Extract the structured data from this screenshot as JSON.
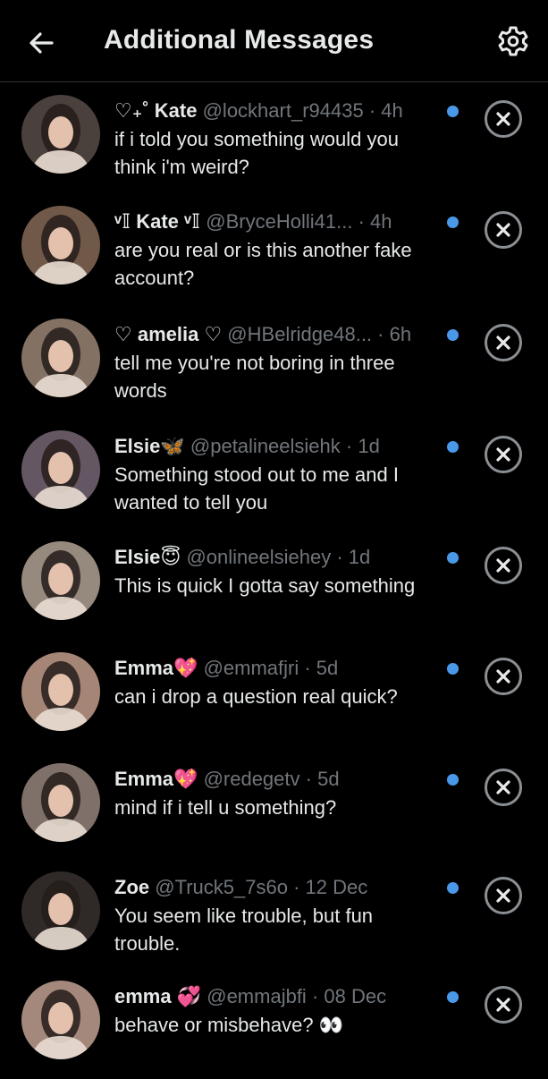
{
  "header": {
    "title": "Additional Messages",
    "back_icon": "arrow-left-icon",
    "settings_icon": "gear-icon"
  },
  "colors": {
    "background": "#000000",
    "text": "#e7e9ea",
    "muted": "#71767b",
    "accent": "#4a99e9"
  },
  "messages": [
    {
      "name": "♡₊˚ Kate",
      "handle": "@lockhart_r94435",
      "time": "4h",
      "text": "if i told you something would you think i'm weird?",
      "avatar": "#5b4f4a"
    },
    {
      "name": "ᵛ𝕀 Kate ᵛ𝕀",
      "handle": "@BryceHolli41...",
      "time": "4h",
      "text": "are you real or is this another fake account?",
      "avatar": "#8a6d5a"
    },
    {
      "name": "♡ amelia ♡",
      "handle": "@HBelridge48...",
      "time": "6h",
      "text": "tell me you're not boring in three words",
      "avatar": "#a08a7a"
    },
    {
      "name": "Elsie🦋",
      "handle": "@petalineelsiehk",
      "time": "1d",
      "text": "Something stood out to me and I wanted to tell you",
      "avatar": "#7a6a78"
    },
    {
      "name": "Elsie😇",
      "handle": "@onlineelsiehey",
      "time": "1d",
      "text": "This is quick I gotta say something",
      "avatar": "#b7a89a"
    },
    {
      "name": "Emma💖",
      "handle": "@emmafjri",
      "time": "5d",
      "text": "can i drop a question real quick?",
      "avatar": "#c9a391"
    },
    {
      "name": "Emma💖",
      "handle": "@redegetv",
      "time": "5d",
      "text": "mind if i tell u something?",
      "avatar": "#9c8a80"
    },
    {
      "name": "Zoe",
      "handle": "@Truck5_7s6o",
      "time": "12 Dec",
      "text": "You seem like trouble, but fun trouble.",
      "avatar": "#3a3230"
    },
    {
      "name": "emma 💞",
      "handle": "@emmajbfi",
      "time": "08 Dec",
      "text": "behave or misbehave? 👀",
      "avatar": "#c7a797"
    }
  ]
}
